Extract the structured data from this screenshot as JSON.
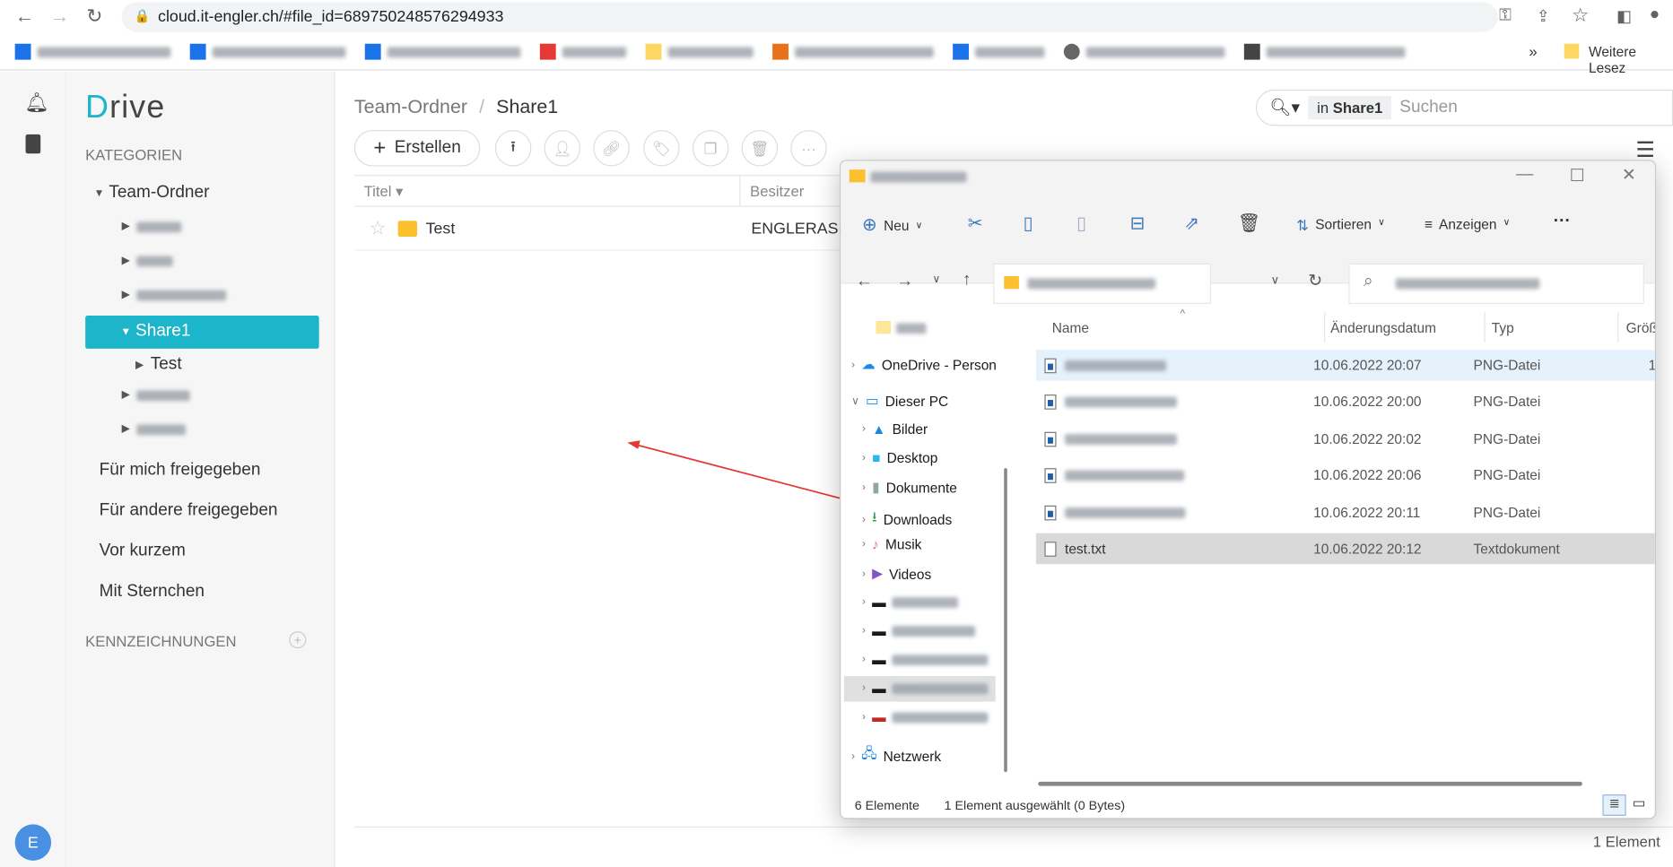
{
  "browser": {
    "url": "cloud.it-engler.ch/#file_id=689750248576294933",
    "more_bookmarks": "»",
    "other_bookmarks": "Weitere Lesez"
  },
  "app": {
    "logo": "Drive",
    "logo_first": "D",
    "logo_rest": "rive",
    "avatar": "E",
    "sidebar": {
      "categories": "KATEGORIEN",
      "root": "Team-Ordner",
      "selected": "Share1",
      "child": "Test",
      "links": [
        "Für mich freigegeben",
        "Für andere freigegeben",
        "Vor kurzem",
        "Mit Sternchen"
      ],
      "tags": "KENNZEICHNUNGEN"
    },
    "breadcrumb": {
      "parent": "Team-Ordner",
      "sep": "/",
      "current": "Share1"
    },
    "toolbar": {
      "create": "Erstellen"
    },
    "search": {
      "scope_prefix": "in",
      "scope": "Share1",
      "placeholder": "Suchen"
    },
    "table": {
      "col_title": "Titel",
      "col_owner": "Besitzer",
      "rows": [
        {
          "name": "Test",
          "owner": "ENGLERASI"
        }
      ]
    },
    "footer": {
      "count": "1 Element"
    }
  },
  "explorer": {
    "toolbar": {
      "new": "Neu",
      "sort": "Sortieren",
      "view": "Anzeigen",
      "more": "···"
    },
    "nav": [
      {
        "label": "OneDrive - Person"
      },
      {
        "label": "Dieser PC"
      },
      {
        "label": "Bilder"
      },
      {
        "label": "Desktop"
      },
      {
        "label": "Dokumente"
      },
      {
        "label": "Downloads"
      },
      {
        "label": "Musik"
      },
      {
        "label": "Videos"
      },
      {
        "label": "Netzwerk"
      }
    ],
    "columns": {
      "name": "Name",
      "date": "Änderungsdatum",
      "type": "Typ",
      "size": "Größ"
    },
    "files": [
      {
        "name": "",
        "date": "10.06.2022 20:07",
        "type": "PNG-Datei"
      },
      {
        "name": "",
        "date": "10.06.2022 20:00",
        "type": "PNG-Datei"
      },
      {
        "name": "",
        "date": "10.06.2022 20:02",
        "type": "PNG-Datei"
      },
      {
        "name": "",
        "date": "10.06.2022 20:06",
        "type": "PNG-Datei"
      },
      {
        "name": "",
        "date": "10.06.2022 20:11",
        "type": "PNG-Datei"
      },
      {
        "name": "test.txt",
        "date": "10.06.2022 20:12",
        "type": "Textdokument"
      }
    ],
    "status": {
      "count": "6 Elemente",
      "selection": "1 Element ausgewählt (0 Bytes)"
    }
  },
  "colors": {
    "accent": "#1cb5c9",
    "arrow": "#e53935",
    "selected_row": "#d9d9d9",
    "hover_row": "#e5f1fb"
  }
}
